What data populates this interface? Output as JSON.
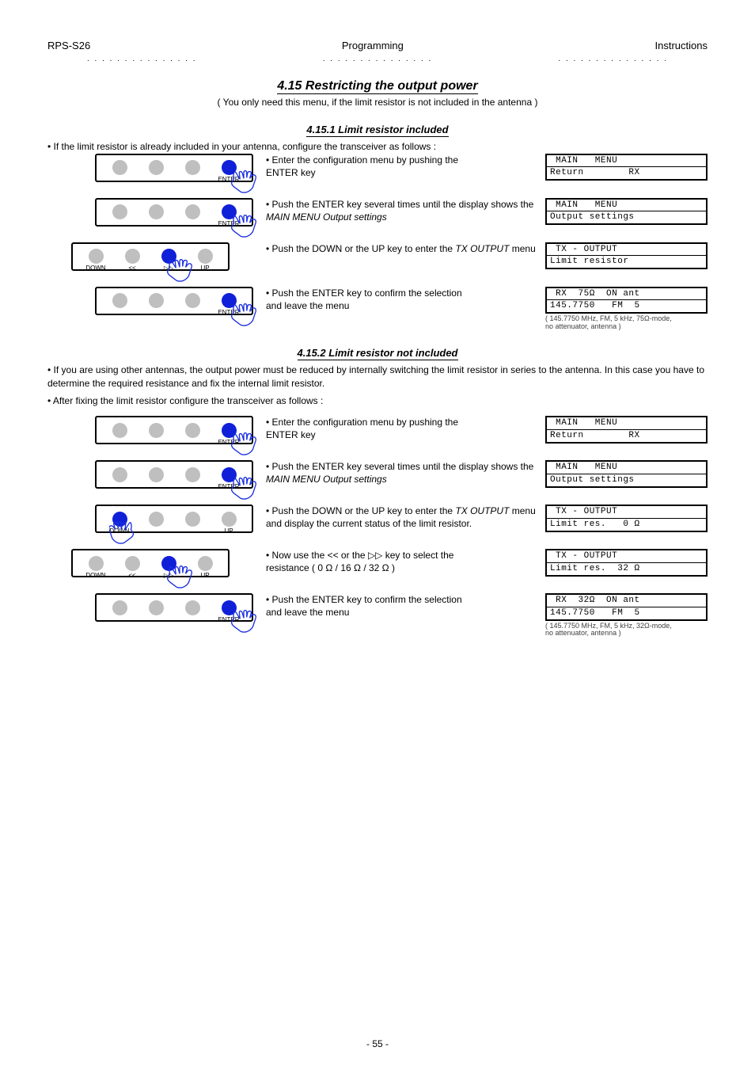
{
  "header": {
    "left": "RPS-S26",
    "center": "Programming",
    "right": "Instructions"
  },
  "dots": ". . . . . . . . . . . . . . .",
  "page": "- 55 -",
  "main_title": "4.15 Restricting the output power",
  "main_note": "( You only need this menu, if the limit resistor is not included in the antenna )",
  "sub1_title": "4.15.1 Limit resistor included",
  "intro1": "• If the limit resistor is already included in your antenna, configure the transceiver as follows :",
  "steps1": [
    {
      "label": "step1",
      "pad": {
        "type": "4r",
        "active": 3,
        "labels": [
          "",
          "",
          "",
          "ENTER"
        ]
      },
      "text": "• Enter the configuration menu by pushing the\n  ENTER key",
      "lcd": [
        " MAIN   MENU",
        "Return        RX"
      ],
      "comment": ""
    },
    {
      "label": "step2",
      "pad": {
        "type": "4r",
        "active": 3,
        "labels": [
          "",
          "",
          "",
          "ENTER"
        ]
      },
      "text_html": "• Push the ENTER key several times until the display shows the <i>MAIN MENU Output settings</i>",
      "lcd": [
        " MAIN   MENU",
        "Output settings"
      ],
      "comment": ""
    },
    {
      "label": "step3",
      "pad": {
        "type": "arrows",
        "active": 2,
        "labels": [
          "DOWN",
          "<<",
          "▷▷",
          "UP"
        ]
      },
      "text_html": "• Push the DOWN or the UP key to enter the <i>TX OUTPUT</i> menu",
      "lcd": [
        " TX - OUTPUT",
        "Limit resistor"
      ],
      "comment": ""
    },
    {
      "label": "step4",
      "pad": {
        "type": "4r",
        "active": 3,
        "labels": [
          "",
          "",
          "",
          "ENTER"
        ]
      },
      "text": "• Push the ENTER key to confirm the selection\n  and leave the menu",
      "lcd": [
        " RX  75Ω  ON ant",
        "145.7750   FM  5"
      ],
      "comment": "( 145.7750 MHz, FM, 5 kHz, 75Ω-mode,\nno attenuator, antenna )"
    }
  ],
  "sub2_title": "4.15.2 Limit resistor not included",
  "intro2_lines": [
    "• If you are using other antennas, the output power must be reduced by internally switching the limit resistor in series to the antenna. In this case you have to determine the required resistance and fix the internal limit resistor.",
    "• After fixing the limit resistor configure the transceiver as follows :"
  ],
  "steps2": [
    {
      "label": "step1",
      "pad": {
        "type": "4r",
        "active": 3,
        "labels": [
          "",
          "",
          "",
          "ENTER"
        ]
      },
      "text": "• Enter the configuration menu by pushing the\n  ENTER key",
      "lcd": [
        " MAIN   MENU",
        "Return        RX"
      ],
      "comment": ""
    },
    {
      "label": "step2",
      "pad": {
        "type": "4r",
        "active": 3,
        "labels": [
          "",
          "",
          "",
          "ENTER"
        ]
      },
      "text_html": "• Push the ENTER key several times until the display shows the <i>MAIN MENU Output settings</i>",
      "lcd": [
        " MAIN   MENU",
        "Output settings"
      ],
      "comment": ""
    },
    {
      "label": "step3",
      "pad": {
        "type": "4l",
        "active": 0,
        "labels": [
          "DOWN",
          "",
          "",
          "UP"
        ]
      },
      "text_html": "• Push the DOWN or the UP key to enter the <i>TX OUTPUT</i> menu and display the current status of the limit resistor.",
      "lcd": [
        " TX - OUTPUT",
        "Limit res.   0 Ω"
      ],
      "comment": ""
    },
    {
      "label": "step4",
      "pad": {
        "type": "arrows",
        "active": 2,
        "labels": [
          "DOWN",
          "<<",
          "▷▷",
          "UP"
        ]
      },
      "text": "• Now use the << or the ▷▷ key to select the\n  resistance ( 0 Ω / 16 Ω / 32 Ω )",
      "lcd": [
        " TX - OUTPUT",
        "Limit res.  32 Ω"
      ],
      "comment": ""
    },
    {
      "label": "step5",
      "pad": {
        "type": "4r",
        "active": 3,
        "labels": [
          "",
          "",
          "",
          "ENTER"
        ]
      },
      "text": "• Push the ENTER key to confirm the selection\n  and leave the menu",
      "lcd": [
        " RX  32Ω  ON ant",
        "145.7750   FM  5"
      ],
      "comment": "( 145.7750 MHz, FM, 5 kHz, 32Ω-mode,\nno attenuator, antenna )"
    }
  ]
}
